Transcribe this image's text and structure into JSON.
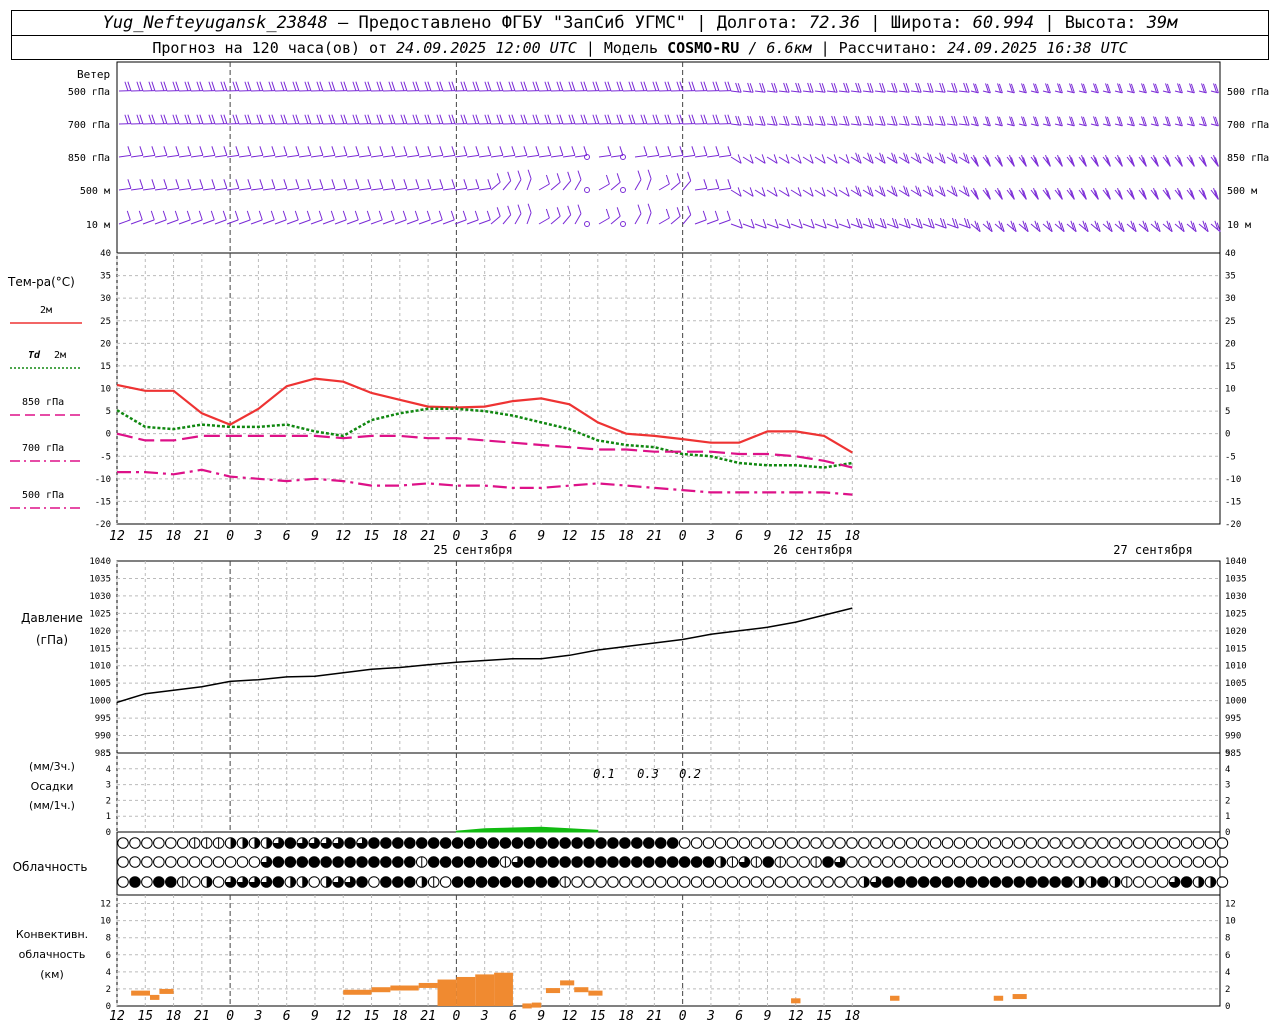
{
  "header": {
    "station": "Yug_Nefteyugansk_23848",
    "provider": "– Предоставлено ФГБУ \"ЗапСиб УГМС\" | Долгота:",
    "lon": "72.36",
    "lat_label": "| Широта:",
    "lat": "60.994",
    "alt_label": "| Высота:",
    "alt": "39м",
    "forecast_prefix": "Прогноз на 120 часа(ов) от",
    "forecast_time": "24.09.2025 12:00 UTC",
    "model_label": "| Модель",
    "model": "COSMO-RU",
    "resolution": "/ 6.6км",
    "calc_label": "| Рассчитано:",
    "calc_time": "24.09.2025 16:38 UTC"
  },
  "labels": {
    "wind": "Ветер",
    "wind_levels": [
      "500 гПа",
      "700 гПа",
      "850 гПа",
      "500 м",
      "10 м"
    ],
    "temp_title": "Тем-ра(°С)",
    "legend": [
      {
        "prefix": "",
        "label": "2м",
        "color": "#ee3333"
      },
      {
        "prefix": "Td",
        "label": "2м",
        "color": "#118811"
      },
      {
        "prefix": "",
        "label": "850 гПа",
        "color": "#dd1188"
      },
      {
        "prefix": "",
        "label": "700 гПа",
        "color": "#dd1188"
      },
      {
        "prefix": "",
        "label": "500 гПа",
        "color": "#dd1188"
      }
    ],
    "pressure": [
      "Давление",
      "(гПа)"
    ],
    "precip": [
      "(мм/3ч.)",
      "Осадки",
      "(мм/1ч.)"
    ],
    "cloud": "Облачность",
    "conv": [
      "Конвективн.",
      "облачность",
      "(км)"
    ],
    "dates": [
      "25 сентября",
      "26 сентября",
      "27 сентября"
    ]
  },
  "chart_data": [
    {
      "type": "barbs",
      "levels": [
        "500 гПа",
        "700 гПа",
        "850 гПа",
        "500 м",
        "10 м"
      ],
      "color": "#7a2ad6"
    },
    {
      "type": "line",
      "hours": [
        12,
        15,
        18,
        21,
        0,
        3,
        6,
        9,
        12,
        15,
        18,
        21,
        0,
        3,
        6,
        9,
        12,
        15,
        18,
        21,
        0,
        3,
        6,
        9,
        12,
        15,
        18
      ],
      "ylim": [
        -20,
        40
      ],
      "yticks": [
        -20,
        -15,
        -10,
        -5,
        0,
        5,
        10,
        15,
        20,
        25,
        30,
        35,
        40
      ],
      "x_step_hours": 3,
      "series": [
        {
          "name": "2м",
          "color": "#ee3333",
          "style": "solid",
          "values": [
            10.8,
            9.5,
            9.5,
            4.5,
            2.0,
            5.5,
            10.5,
            12.2,
            11.5,
            9.0,
            7.5,
            6.0,
            5.8,
            6.0,
            7.2,
            7.8,
            6.5,
            2.5,
            0.0,
            -0.5,
            -1.2,
            -2.0,
            -2.0,
            0.5,
            0.5,
            -0.5,
            -4.2
          ]
        },
        {
          "name": "Td 2м",
          "color": "#118811",
          "style": "dotted",
          "values": [
            5.2,
            1.5,
            1.0,
            2.0,
            1.5,
            1.5,
            2.0,
            0.5,
            -0.5,
            3.0,
            4.5,
            5.5,
            5.5,
            5.0,
            4.0,
            2.5,
            1.0,
            -1.5,
            -2.5,
            -3.0,
            -4.5,
            -5.0,
            -6.5,
            -7.0,
            -7.0,
            -7.5,
            -6.5
          ]
        },
        {
          "name": "850 гПа",
          "color": "#dd1188",
          "style": "dashed",
          "values": [
            0.0,
            -1.5,
            -1.5,
            -0.5,
            -0.5,
            -0.5,
            -0.5,
            -0.5,
            -1.0,
            -0.5,
            -0.5,
            -1.0,
            -1.0,
            -1.5,
            -2.0,
            -2.5,
            -3.0,
            -3.5,
            -3.5,
            -4.0,
            -4.0,
            -4.0,
            -4.5,
            -4.5,
            -5.0,
            -6.0,
            -7.5
          ]
        },
        {
          "name": "700 гПа",
          "color": "#dd1188",
          "style": "dashdot",
          "values": [
            -8.5,
            -8.5,
            -9.0,
            -8.0,
            -9.5,
            -10.0,
            -10.5,
            -10.0,
            -10.5,
            -11.5,
            -11.5,
            -11.0,
            -11.5,
            -11.5,
            -12.0,
            -12.0,
            -11.5,
            -11.0,
            -11.5,
            -12.0,
            -12.5,
            -13.0,
            -13.0,
            -13.0,
            -13.0,
            -13.0,
            -13.5
          ]
        }
      ]
    },
    {
      "type": "line",
      "hours": [
        12,
        15,
        18,
        21,
        0,
        3,
        6,
        9,
        12,
        15,
        18,
        21,
        0,
        3,
        6,
        9,
        12,
        15,
        18,
        21,
        0,
        3,
        6,
        9,
        12,
        15,
        18
      ],
      "ylim": [
        985,
        1040
      ],
      "yticks": [
        985,
        990,
        995,
        1000,
        1005,
        1010,
        1015,
        1020,
        1025,
        1030,
        1035,
        1040
      ],
      "series": [
        {
          "name": "Давление",
          "color": "#000000",
          "values": [
            999.5,
            1002.0,
            1003.0,
            1004.0,
            1005.5,
            1006.0,
            1006.8,
            1007.0,
            1008.0,
            1009.0,
            1009.5,
            1010.3,
            1011.0,
            1011.5,
            1012.0,
            1012.0,
            1013.0,
            1014.5,
            1015.5,
            1016.5,
            1017.5,
            1019.0,
            1020.0,
            1021.0,
            1022.5,
            1024.5,
            1026.5
          ]
        }
      ]
    },
    {
      "type": "area",
      "ylim": [
        0,
        5
      ],
      "yticks": [
        0,
        1,
        2,
        3,
        4,
        5
      ],
      "annotations": [
        "0.1",
        "0.3",
        "0.2"
      ],
      "color": "#11bb11",
      "x_start_hour": 0,
      "values": [
        0.05,
        0.2,
        0.25,
        0.3,
        0.2,
        0.1
      ]
    },
    {
      "type": "table",
      "rows": [
        "000000111222234333343444444444444444444444444440000000000000000000000000000000000000000000000",
        "000000000000344444444444414444441344444444444444442131410014300000000000000000000000000000000",
        "040441020333342202334044421044444444410000000000000000000000002344444444444444442242100034220"
      ]
    },
    {
      "type": "bar",
      "ylim": [
        0,
        13
      ],
      "yticks": [
        0,
        2,
        4,
        6,
        8,
        10,
        12
      ],
      "color": "#f08a30",
      "bars": [
        {
          "start": 1.5,
          "end": 3.5,
          "value": 1.8
        },
        {
          "start": 3.5,
          "end": 4.5,
          "value": 1.3
        },
        {
          "start": 4.5,
          "end": 6.0,
          "value": 2.0
        },
        {
          "start": 24.0,
          "end": 27.0,
          "value": 1.9
        },
        {
          "start": 27.0,
          "end": 29.0,
          "value": 2.2
        },
        {
          "start": 29.0,
          "end": 32.0,
          "value": 2.4
        },
        {
          "start": 32.0,
          "end": 34.0,
          "value": 2.7
        },
        {
          "start": 34.0,
          "end": 36.0,
          "value": 3.1
        },
        {
          "start": 36.0,
          "end": 38.0,
          "value": 3.4
        },
        {
          "start": 38.0,
          "end": 40.0,
          "value": 3.7
        },
        {
          "start": 40.0,
          "end": 42.0,
          "value": 3.9
        },
        {
          "start": 43.0,
          "end": 44.0,
          "value": 0.3
        },
        {
          "start": 44.0,
          "end": 45.0,
          "value": 0.4
        },
        {
          "start": 45.5,
          "end": 47.0,
          "value": 2.1
        },
        {
          "start": 47.0,
          "end": 48.5,
          "value": 3.0
        },
        {
          "start": 48.5,
          "end": 50.0,
          "value": 2.2
        },
        {
          "start": 50.0,
          "end": 51.5,
          "value": 1.8
        },
        {
          "start": 71.5,
          "end": 72.5,
          "value": 0.9
        },
        {
          "start": 82.0,
          "end": 83.0,
          "value": 1.2
        },
        {
          "start": 93.0,
          "end": 94.0,
          "value": 1.2
        },
        {
          "start": 95.0,
          "end": 96.5,
          "value": 1.4
        }
      ]
    }
  ]
}
